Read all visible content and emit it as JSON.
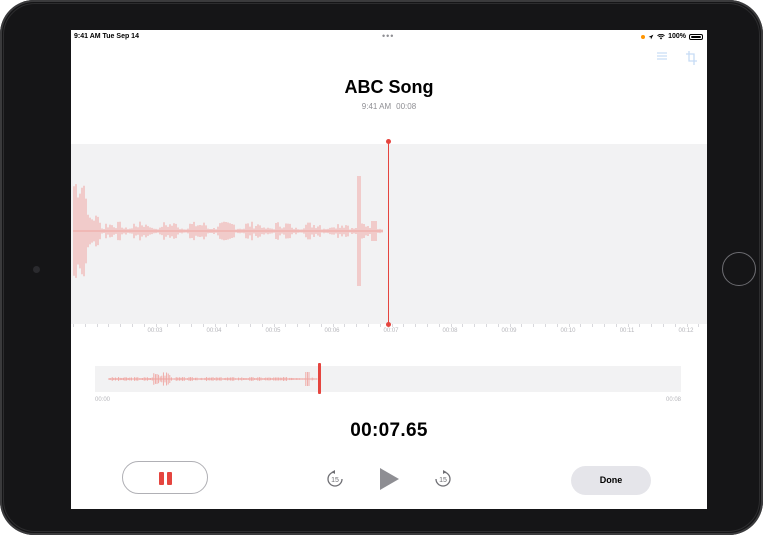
{
  "status_bar": {
    "time": "9:41 AM  Tue Sep 14",
    "battery": "100%"
  },
  "recording": {
    "title": "ABC Song",
    "time": "9:41 AM",
    "duration": "00:08"
  },
  "timeline": {
    "labels": [
      "00:03",
      "00:04",
      "00:05",
      "00:06",
      "00:07",
      "00:08",
      "00:09",
      "00:10",
      "00:11",
      "00:12"
    ],
    "playhead_seconds": 7.65,
    "recorded_seconds": 8
  },
  "overview": {
    "start": "00:00",
    "end": "00:08",
    "position_fraction": 0.38
  },
  "timer": "00:07.65",
  "controls": {
    "skip_back": "15",
    "skip_forward": "15",
    "done_label": "Done"
  },
  "colors": {
    "accent": "#e5453f",
    "waveform": "#f0a4a0",
    "tool_icons": "#c6dcf5"
  },
  "icons": [
    "options-icon",
    "trim-icon",
    "pause-icon",
    "skip-back-15-icon",
    "play-icon",
    "skip-forward-15-icon"
  ]
}
